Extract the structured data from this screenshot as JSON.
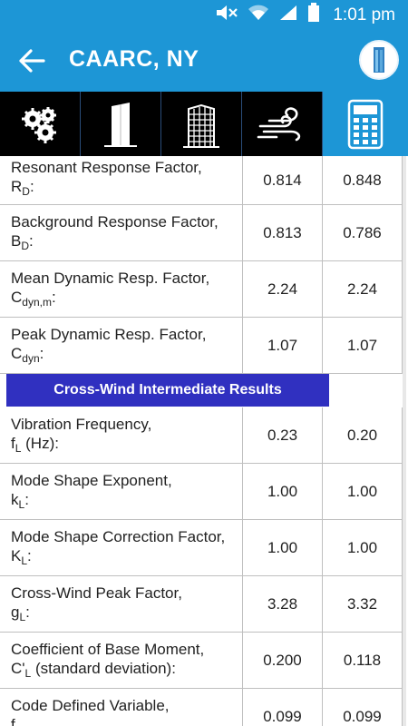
{
  "status_bar": {
    "time": "1:01 pm"
  },
  "app_bar": {
    "title": "CAARC, NY"
  },
  "tabs": [
    {
      "name": "settings-tab"
    },
    {
      "name": "building-tab"
    },
    {
      "name": "building-detail-tab"
    },
    {
      "name": "wind-tab"
    },
    {
      "name": "calculator-tab",
      "active": true
    }
  ],
  "rows_top": [
    {
      "label": "Resonant Response Factor,",
      "sym": "R",
      "sub": "D",
      "suffix": ":",
      "v1": "0.814",
      "v2": "0.848"
    },
    {
      "label": "Background Response Factor,",
      "sym": "B",
      "sub": "D",
      "suffix": ":",
      "v1": "0.813",
      "v2": "0.786"
    },
    {
      "label": "Mean Dynamic Resp. Factor,",
      "sym": "C",
      "sub": "dyn,m",
      "suffix": ":",
      "v1": "2.24",
      "v2": "2.24"
    },
    {
      "label": "Peak Dynamic Resp. Factor,",
      "sym": "C",
      "sub": "dyn",
      "suffix": ":",
      "v1": "1.07",
      "v2": "1.07"
    }
  ],
  "section": {
    "title": "Cross-Wind Intermediate Results"
  },
  "rows_bottom": [
    {
      "label": "Vibration Frequency,",
      "sym": "f",
      "sub": "L",
      "suffix": " (Hz):",
      "v1": "0.23",
      "v2": "0.20"
    },
    {
      "label": "Mode Shape Exponent,",
      "sym": "k",
      "sub": "L",
      "suffix": ":",
      "v1": "1.00",
      "v2": "1.00"
    },
    {
      "label": "Mode Shape Correction Factor,",
      "sym": "K",
      "sub": "L",
      "suffix": ":",
      "v1": "1.00",
      "v2": "1.00"
    },
    {
      "label": "Cross-Wind Peak Factor,",
      "sym": "g",
      "sub": "L",
      "suffix": ":",
      "v1": "3.28",
      "v2": "3.32"
    },
    {
      "label": "Coefficient of Base Moment,",
      "sym": "C'",
      "sub": "L",
      "suffix": " (standard deviation):",
      "v1": "0.200",
      "v2": "0.118"
    },
    {
      "label": "Code Defined Variable,",
      "sym": "f",
      "sub": "...",
      "suffix": "",
      "v1": "0.099",
      "v2": "0.099"
    }
  ]
}
